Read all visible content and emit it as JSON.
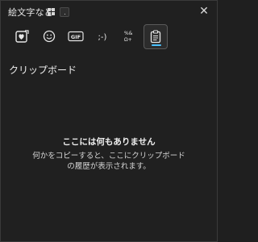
{
  "titlebar": {
    "title": "絵文字など",
    "close_glyph": "✕",
    "icons": [
      "windows-logo-icon",
      "dot-icon",
      "close-icon"
    ]
  },
  "tabs": [
    {
      "id": "emoji-favorites",
      "icon": "heart-favorites-icon"
    },
    {
      "id": "emoji",
      "icon": "smiley-icon"
    },
    {
      "id": "gif",
      "icon": "gif-icon",
      "label": "GIF"
    },
    {
      "id": "kaomoji",
      "icon": "kaomoji-icon",
      "label": ";-)"
    },
    {
      "id": "symbols",
      "icon": "symbols-icon",
      "label": "%&Ω+"
    },
    {
      "id": "clipboard",
      "icon": "clipboard-icon",
      "active": true
    }
  ],
  "clipboard": {
    "section_title": "クリップボード",
    "empty_heading": "ここには何もありません",
    "empty_line1": "何かをコピーすると、ここにクリップボード",
    "empty_line2": "の履歴が表示されます。"
  },
  "colors": {
    "background": "#202020",
    "accent": "#4cc2ff",
    "text": "#e8e8e8"
  }
}
